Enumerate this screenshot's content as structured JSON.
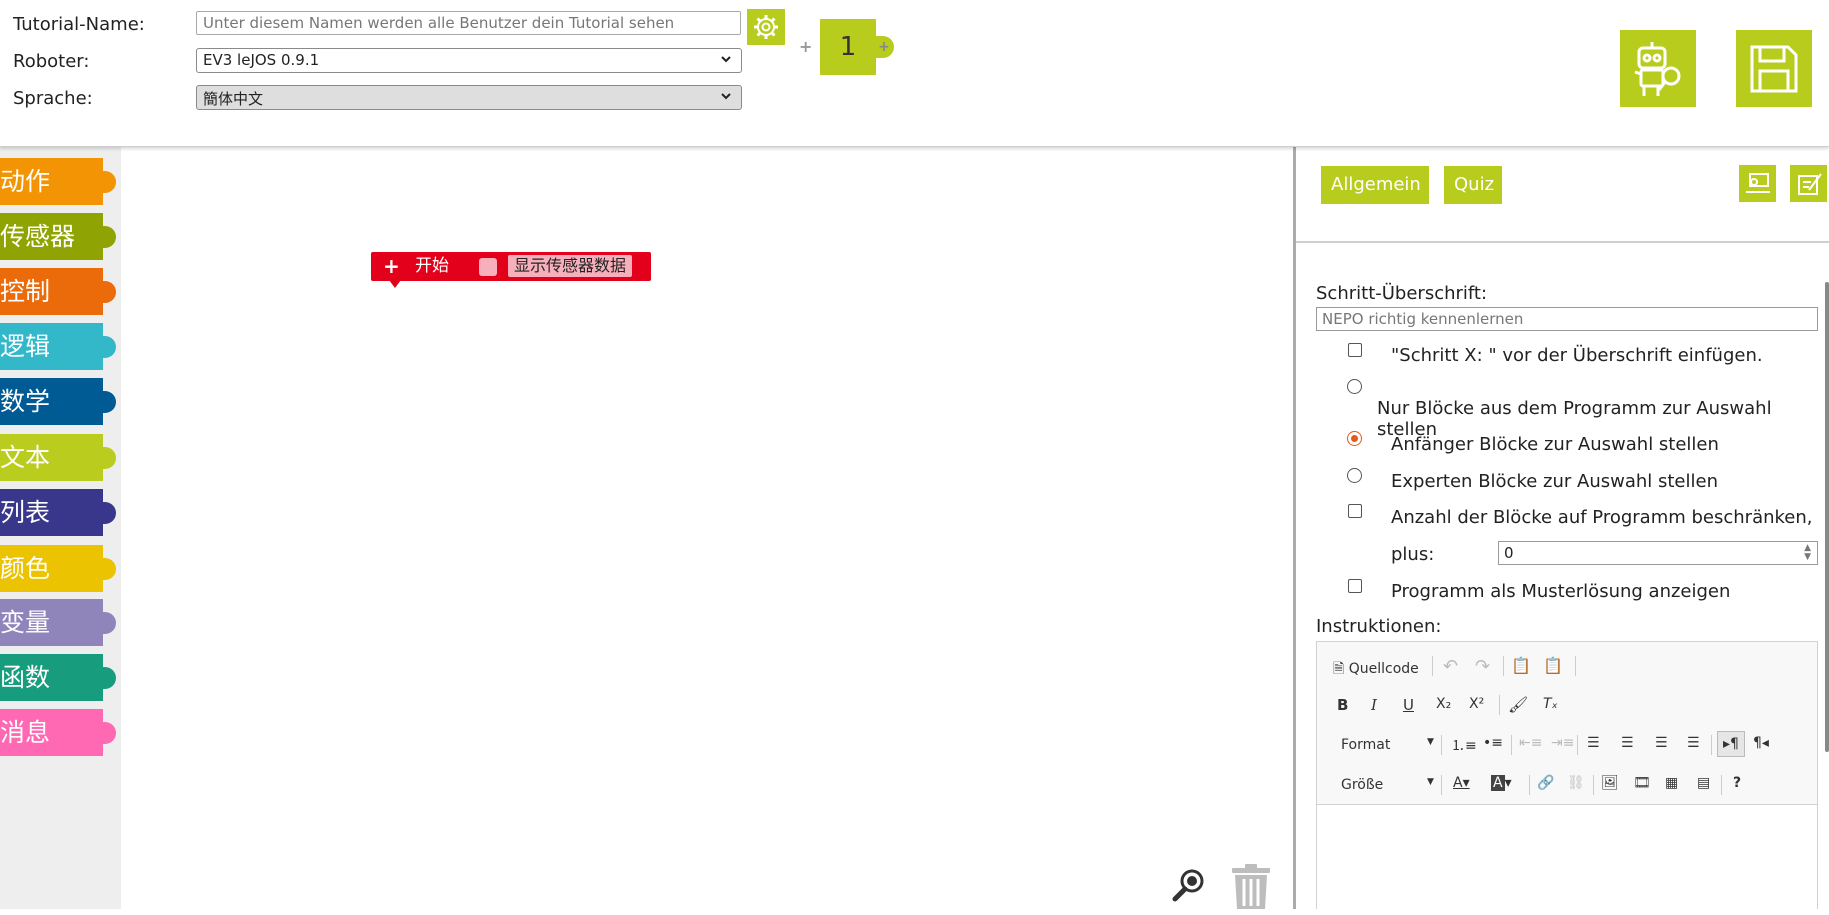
{
  "header": {
    "tutorial_name_label": "Tutorial-Name:",
    "tutorial_name_placeholder": "Unter diesem Namen werden alle Benutzer dein Tutorial sehen",
    "robot_label": "Roboter:",
    "robot_value": "EV3 leJOS 0.9.1",
    "language_label": "Sprache:",
    "language_value": "簡体中文",
    "plus_left": "+",
    "step_count": "1",
    "plus_right": "+"
  },
  "toolbox": {
    "categories": [
      {
        "label": "动作",
        "color": "#f39404"
      },
      {
        "label": "传感器",
        "color": "#8fa402"
      },
      {
        "label": "控制",
        "color": "#eb6a0a"
      },
      {
        "label": "逻辑",
        "color": "#33b8ca"
      },
      {
        "label": "数学",
        "color": "#005a94"
      },
      {
        "label": "文本",
        "color": "#bacc1e"
      },
      {
        "label": "列表",
        "color": "#39378b"
      },
      {
        "label": "颜色",
        "color": "#ebc300"
      },
      {
        "label": "变量",
        "color": "#9085ba"
      },
      {
        "label": "函数",
        "color": "#179c7d"
      },
      {
        "label": "消息",
        "color": "#ff69b4"
      }
    ]
  },
  "workspace": {
    "start_plus": "+",
    "start_label": "开始",
    "sensor_label": "显示传感器数据"
  },
  "panel": {
    "tabs": [
      "Allgemein",
      "Quiz"
    ],
    "step_heading_label": "Schritt-Überschrift:",
    "step_heading_placeholder": "NEPO richtig kennenlernen",
    "options": {
      "prefix": "\"Schritt X: \" vor der Überschrift einfügen.",
      "only_program": "Nur Blöcke aus dem Programm zur Auswahl stellen",
      "beginner": "Anfänger Blöcke zur Auswahl stellen",
      "expert": "Experten Blöcke zur Auswahl stellen",
      "limit": "Anzahl der Blöcke auf Programm beschränken,",
      "plus_label": "plus:",
      "plus_value": "0",
      "solution": "Programm als Musterlösung anzeigen"
    },
    "instructions_label": "Instruktionen:",
    "editor": {
      "source": "Quellcode",
      "format": "Format",
      "size": "Größe",
      "bold": "B",
      "italic": "I",
      "underline": "U",
      "help": "?"
    }
  },
  "colors": {
    "accent": "#b8cc1e",
    "start_block": "#e2001a",
    "radio_selected": "#e35a1c"
  }
}
